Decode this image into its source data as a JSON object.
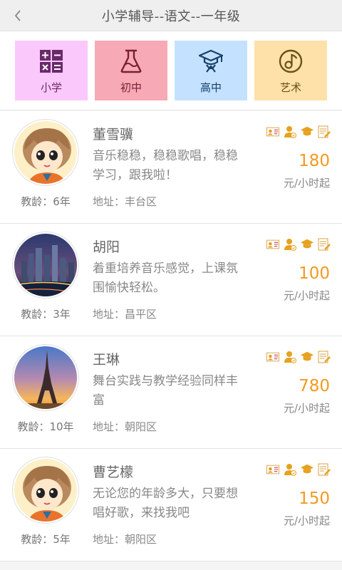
{
  "header": {
    "title": "小学辅导--语文--一年级"
  },
  "categories": [
    {
      "label": "小学",
      "icon": "calculator-icon",
      "bg": "#fbc8fb",
      "color": "#6a2a6a"
    },
    {
      "label": "初中",
      "icon": "flask-icon",
      "bg": "#f7a9b6",
      "color": "#7a1e33"
    },
    {
      "label": "高中",
      "icon": "graduation-cap-icon",
      "bg": "#c4e2ff",
      "color": "#173f6b"
    },
    {
      "label": "艺术",
      "icon": "music-note-icon",
      "bg": "#fde1a8",
      "color": "#6a5118"
    }
  ],
  "teachers": [
    {
      "name": "董雪骥",
      "desc": "音乐稳稳，稳稳歌唱，稳稳学习，跟我啦！",
      "exp": "教龄：6年",
      "addr": "地址：丰台区",
      "price": "180",
      "unit": "元/小时起",
      "avatar": "cartoon-girl"
    },
    {
      "name": "胡阳",
      "desc": "着重培养音乐感觉，上课氛围愉快轻松。",
      "exp": "教龄：3年",
      "addr": "地址：昌平区",
      "price": "100",
      "unit": "元/小时起",
      "avatar": "city-night"
    },
    {
      "name": "王琳",
      "desc": "舞台实践与教学经验同样丰富",
      "exp": "教龄：10年",
      "addr": "地址：朝阳区",
      "price": "780",
      "unit": "元/小时起",
      "avatar": "eiffel-tower"
    },
    {
      "name": "曹艺檬",
      "desc": "无论您的年龄多大，只要想唱好歌，来找我吧",
      "exp": "教龄：5年",
      "addr": "地址：朝阳区",
      "price": "150",
      "unit": "元/小时起",
      "avatar": "cartoon-girl"
    }
  ],
  "badge_icons": [
    "id-card-icon",
    "verified-user-icon",
    "graduation-cap-icon",
    "certificate-icon"
  ],
  "colors": {
    "price": "#f39a1f",
    "badge": "#f0a020"
  }
}
